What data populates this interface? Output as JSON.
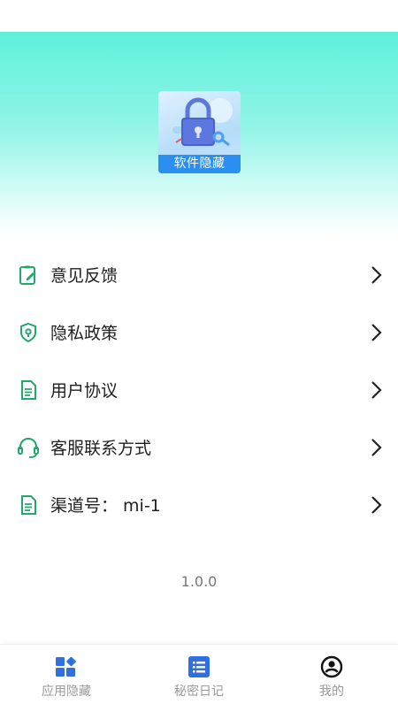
{
  "app": {
    "logo_label": "软件隐藏",
    "version": "1.0.0"
  },
  "menu": {
    "items": [
      {
        "label": "意见反馈",
        "icon": "feedback-icon"
      },
      {
        "label": "隐私政策",
        "icon": "privacy-shield-icon"
      },
      {
        "label": "用户协议",
        "icon": "document-icon"
      },
      {
        "label": "客服联系方式",
        "icon": "headset-icon"
      },
      {
        "label": "渠道号： mi-1",
        "icon": "document-icon"
      }
    ]
  },
  "tabbar": {
    "tabs": [
      {
        "label": "应用隐藏",
        "icon": "apps-icon"
      },
      {
        "label": "秘密日记",
        "icon": "list-icon"
      },
      {
        "label": "我的",
        "icon": "profile-icon"
      }
    ]
  },
  "colors": {
    "accent_green": "#21a86a",
    "tab_active_blue": "#2f6fe0",
    "hero_teal": "#5ef0dc"
  }
}
